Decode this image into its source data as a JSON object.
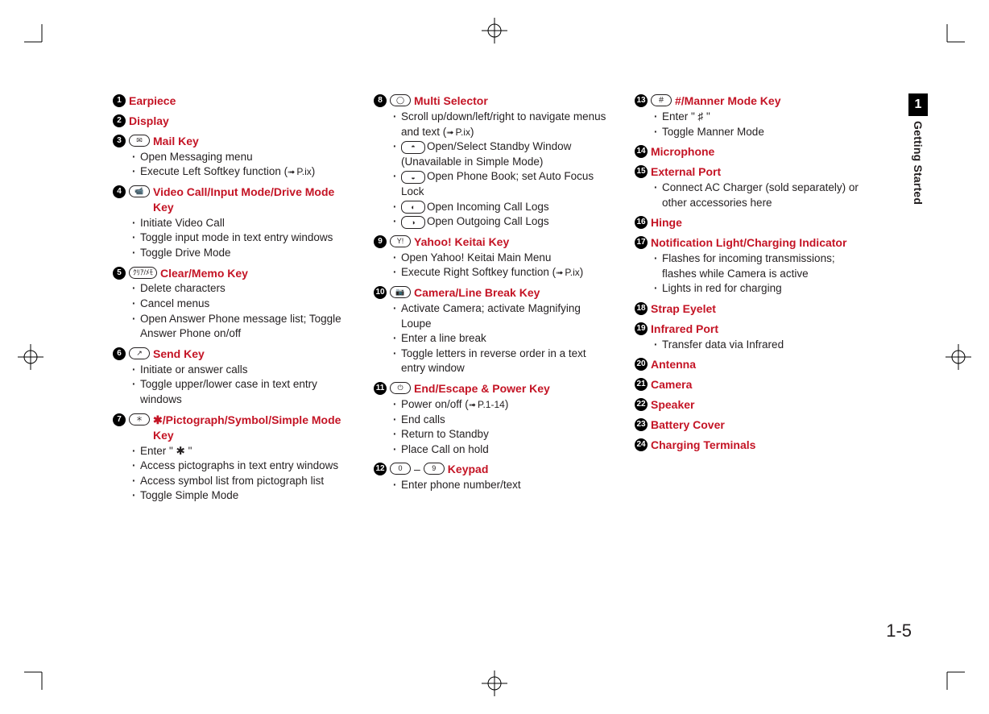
{
  "chapter": {
    "number": "1",
    "title": "Getting Started"
  },
  "page_number": "1-5",
  "ref_default": "P.ix",
  "entries": [
    {
      "n": "1",
      "title": "Earpiece"
    },
    {
      "n": "2",
      "title": "Display"
    },
    {
      "n": "3",
      "icon": "✉",
      "title": "Mail Key",
      "sub": [
        {
          "t": "Open Messaging menu"
        },
        {
          "t": "Execute Left Softkey function (",
          "ref": "P.ix",
          "t2": ")"
        }
      ]
    },
    {
      "n": "4",
      "icon": "📹",
      "title": " Video Call/Input Mode/Drive Mode Key",
      "sub": [
        {
          "t": "Initiate Video Call"
        },
        {
          "t": "Toggle input mode in text entry windows"
        },
        {
          "t": "Toggle Drive Mode"
        }
      ]
    },
    {
      "n": "5",
      "icon": "ｸﾘｱ/ﾒﾓ",
      "title": "Clear/Memo Key",
      "sub": [
        {
          "t": "Delete characters"
        },
        {
          "t": "Cancel menus"
        },
        {
          "t": "Open Answer Phone message list; Toggle Answer Phone on/off"
        }
      ]
    },
    {
      "n": "6",
      "icon": "↗",
      "title": "Send Key",
      "sub": [
        {
          "t": "Initiate or answer calls"
        },
        {
          "t": "Toggle upper/lower case in text entry windows"
        }
      ]
    },
    {
      "n": "7",
      "icon": "＊",
      "title": "✱/Pictograph/Symbol/Simple Mode Key",
      "sub": [
        {
          "t": "Enter \" ✱ \""
        },
        {
          "t": "Access pictographs in text entry windows"
        },
        {
          "t": "Access symbol list from pictograph list"
        },
        {
          "t": "Toggle Simple Mode"
        }
      ]
    },
    {
      "n": "8",
      "icon": "◯",
      "title": "Multi Selector",
      "sub": [
        {
          "t": "Scroll up/down/left/right to navigate menus and text (",
          "ref": "P.ix",
          "t2": ")"
        },
        {
          "key": "◓",
          "t": "Open/Select Standby Window (Unavailable in Simple Mode)"
        },
        {
          "key": "◒",
          "t": "Open Phone Book; set Auto Focus Lock"
        },
        {
          "key": "◐",
          "t": "Open Incoming Call Logs"
        },
        {
          "key": "◑",
          "t": "Open Outgoing Call Logs"
        }
      ]
    },
    {
      "n": "9",
      "icon": "Y!",
      "title": "Yahoo! Keitai Key",
      "sub": [
        {
          "t": "Open Yahoo! Keitai Main Menu"
        },
        {
          "t": "Execute Right Softkey function (",
          "ref": "P.ix",
          "t2": ")"
        }
      ]
    },
    {
      "n": "10",
      "icon": "📷",
      "title": "Camera/Line Break Key",
      "sub": [
        {
          "t": "Activate Camera; activate Magnifying Loupe"
        },
        {
          "t": "Enter a line break"
        },
        {
          "t": "Toggle letters in reverse order in a text entry window"
        }
      ]
    },
    {
      "n": "11",
      "icon": "⏻",
      "title": "End/Escape & Power Key",
      "sub": [
        {
          "t": "Power on/off (",
          "ref": "P.1-14",
          "t2": ")"
        },
        {
          "t": "End calls"
        },
        {
          "t": "Return to Standby"
        },
        {
          "t": "Place Call on hold"
        }
      ]
    },
    {
      "n": "12",
      "icon_range": {
        "from": "0",
        "to": "9"
      },
      "title": "Keypad",
      "sub": [
        {
          "t": "Enter phone number/text"
        }
      ]
    },
    {
      "n": "13",
      "icon": "＃",
      "title": "#/Manner Mode Key",
      "sub": [
        {
          "t": "Enter \" ♯ \""
        },
        {
          "t": "Toggle Manner Mode"
        }
      ]
    },
    {
      "n": "14",
      "title": "Microphone"
    },
    {
      "n": "15",
      "title": "External Port",
      "sub": [
        {
          "t": "Connect AC Charger (sold separately) or other accessories here"
        }
      ]
    },
    {
      "n": "16",
      "title": "Hinge"
    },
    {
      "n": "17",
      "title": "Notification Light/Charging Indicator",
      "sub": [
        {
          "t": "Flashes for incoming transmissions; flashes while Camera is active"
        },
        {
          "t": "Lights in red for charging"
        }
      ]
    },
    {
      "n": "18",
      "title": "Strap Eyelet"
    },
    {
      "n": "19",
      "title": "Infrared Port",
      "sub": [
        {
          "t": "Transfer data via Infrared"
        }
      ]
    },
    {
      "n": "20",
      "title": "Antenna"
    },
    {
      "n": "21",
      "title": "Camera"
    },
    {
      "n": "22",
      "title": "Speaker"
    },
    {
      "n": "23",
      "title": "Battery Cover"
    },
    {
      "n": "24",
      "title": "Charging Terminals"
    }
  ],
  "column_split": [
    7,
    12
  ]
}
